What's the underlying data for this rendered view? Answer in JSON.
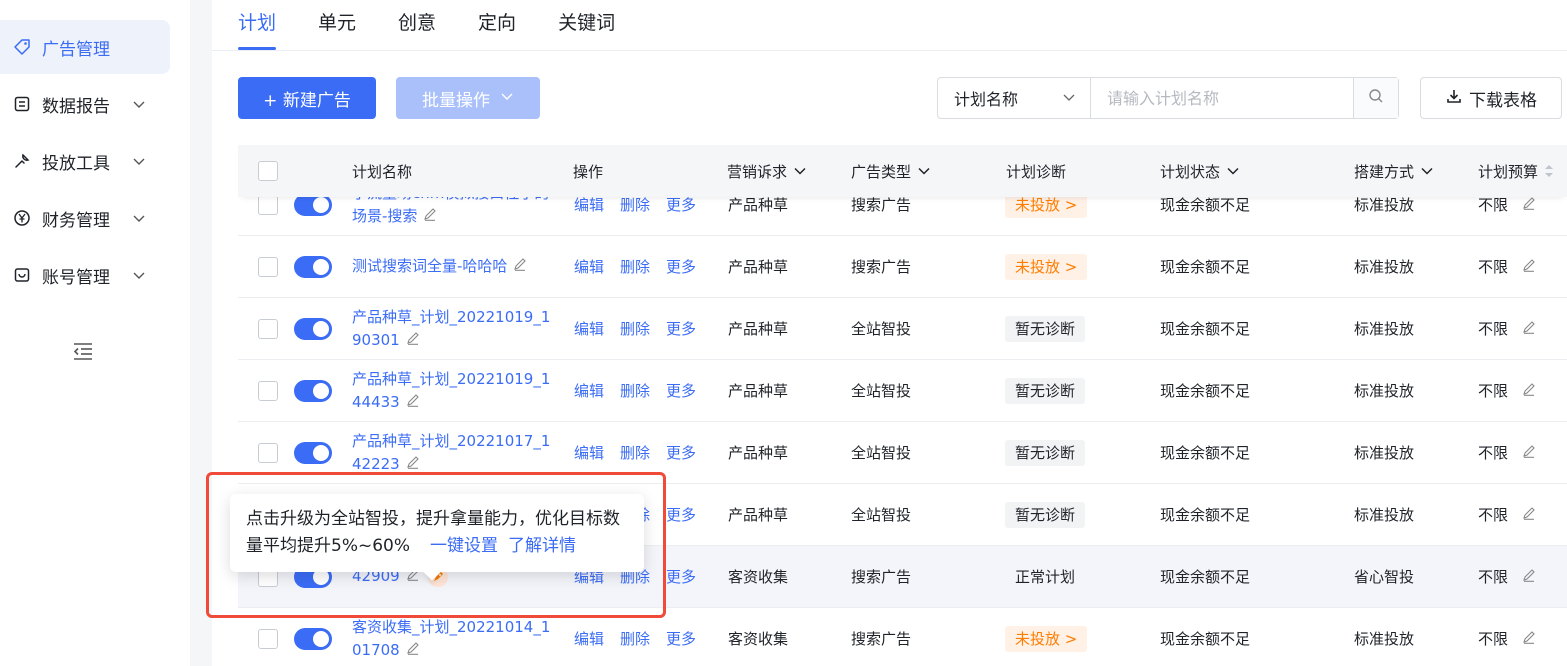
{
  "sidebar": {
    "items": [
      {
        "label": "广告管理",
        "icon": "tag-icon",
        "active": true
      },
      {
        "label": "数据报告",
        "icon": "report-icon"
      },
      {
        "label": "投放工具",
        "icon": "tool-icon"
      },
      {
        "label": "财务管理",
        "icon": "yen-icon"
      },
      {
        "label": "账号管理",
        "icon": "account-icon"
      }
    ]
  },
  "tabs": [
    "计划",
    "单元",
    "创意",
    "定向",
    "关键词"
  ],
  "toolbar": {
    "new_ad": "+ 新建广告",
    "batch": "批量操作",
    "search_field": "计划名称",
    "search_placeholder": "请输入计划名称",
    "download": "下载表格"
  },
  "table": {
    "headers": {
      "name": "计划名称",
      "ops": "操作",
      "goal": "营销诉求",
      "type": "广告类型",
      "diag": "计划诊断",
      "status": "计划状态",
      "build": "搭建方式",
      "budget": "计划预算"
    },
    "op_labels": {
      "edit": "编辑",
      "delete": "删除",
      "more": "更多"
    },
    "rows": [
      {
        "name_l1": "小流量场cnm模拟接口性子的",
        "name_l2": "场景-搜索",
        "goal": "产品种草",
        "type": "搜索广告",
        "diag": "未投放 >",
        "diag_kind": "warn",
        "status": "现金余额不足",
        "build": "标准投放",
        "budget": "不限"
      },
      {
        "name_l1": "测试搜索词全量-哈哈哈",
        "name_l2": "",
        "goal": "产品种草",
        "type": "搜索广告",
        "diag": "未投放 >",
        "diag_kind": "warn",
        "status": "现金余额不足",
        "build": "标准投放",
        "budget": "不限"
      },
      {
        "name_l1": "产品种草_计划_20221019_1",
        "name_l2": "90301",
        "goal": "产品种草",
        "type": "全站智投",
        "diag": "暂无诊断",
        "diag_kind": "none",
        "status": "现金余额不足",
        "build": "标准投放",
        "budget": "不限"
      },
      {
        "name_l1": "产品种草_计划_20221019_1",
        "name_l2": "44433",
        "goal": "产品种草",
        "type": "全站智投",
        "diag": "暂无诊断",
        "diag_kind": "none",
        "status": "现金余额不足",
        "build": "标准投放",
        "budget": "不限"
      },
      {
        "name_l1": "产品种草_计划_20221017_1",
        "name_l2": "42223",
        "goal": "产品种草",
        "type": "全站智投",
        "diag": "暂无诊断",
        "diag_kind": "none",
        "status": "现金余额不足",
        "build": "标准投放",
        "budget": "不限"
      },
      {
        "name_l1": "",
        "name_l2": "",
        "goal": "产品种草",
        "type": "全站智投",
        "diag": "暂无诊断",
        "diag_kind": "none",
        "status": "现金余额不足",
        "build": "标准投放",
        "budget": "不限"
      },
      {
        "name_l1": "",
        "name_l2": "42909",
        "goal": "客资收集",
        "type": "搜索广告",
        "diag": "正常计划",
        "diag_kind": "normal",
        "status": "现金余额不足",
        "build": "省心智投",
        "budget": "不限"
      },
      {
        "name_l1": "客资收集_计划_20221014_1",
        "name_l2": "01708",
        "goal": "客资收集",
        "type": "搜索广告",
        "diag": "未投放 >",
        "diag_kind": "warn",
        "status": "现金余额不足",
        "build": "标准投放",
        "budget": "不限"
      }
    ]
  },
  "tooltip": {
    "text": "点击升级为全站智投，提升拿量能力，优化目标数量平均提升5%~60%",
    "link1": "一键设置",
    "link2": "了解详情"
  },
  "colors": {
    "primary": "#3b6cf6",
    "warn": "#ff7d00",
    "highlight": "#f04a38"
  }
}
